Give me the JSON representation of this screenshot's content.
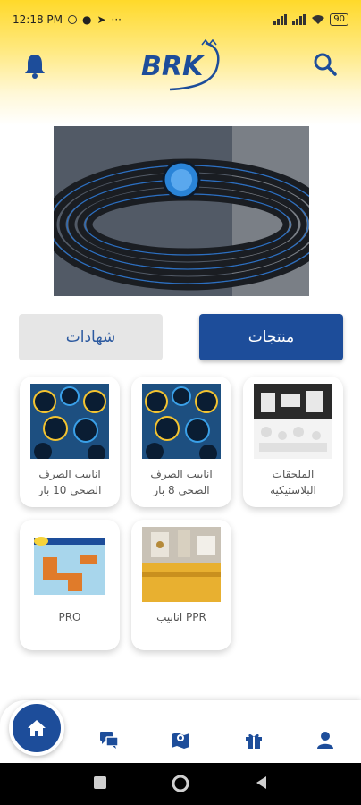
{
  "status_bar": {
    "time": "12:18 PM",
    "more": "···",
    "battery": "90"
  },
  "header": {
    "logo_text": "BRK"
  },
  "tabs": {
    "products": "منتجات",
    "certificates": "شهادات"
  },
  "products": [
    {
      "title": "الملحقات البلاستيكيه"
    },
    {
      "title": "انابيب الصرف الصحي 8 بار"
    },
    {
      "title": "انابيب الصرف الصحي 10 بار"
    },
    {
      "title": "PPR انابيب"
    },
    {
      "title": "PRO"
    }
  ],
  "colors": {
    "primary": "#1d4d9a",
    "header_yellow": "#ffd92a",
    "tab_inactive": "#e6e6e6"
  },
  "nav": {
    "items": [
      "home-icon",
      "chat-icon",
      "map-icon",
      "gift-icon",
      "profile-icon"
    ]
  }
}
